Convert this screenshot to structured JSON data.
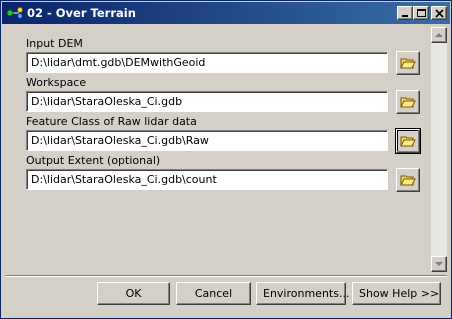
{
  "window": {
    "title": "02 - Over Terrain",
    "icon": "model-tool-icon",
    "controls": [
      "minimize-icon",
      "maximize-icon",
      "close-icon"
    ]
  },
  "parameters": [
    {
      "label": "Input DEM",
      "value": "D:\\lidar\\dmt.gdb\\DEMwithGeoid",
      "browse_icon": "open-folder-icon"
    },
    {
      "label": "Workspace",
      "value": "D:\\lidar\\StaraOleska_Ci.gdb",
      "browse_icon": "open-folder-icon"
    },
    {
      "label": "Feature Class of Raw lidar data",
      "value": "D:\\lidar\\StaraOleska_Ci.gdb\\Raw",
      "browse_icon": "open-folder-icon"
    },
    {
      "label": "Output Extent (optional)",
      "value": "D:\\lidar\\StaraOleska_Ci.gdb\\count",
      "browse_icon": "open-folder-icon"
    }
  ],
  "buttons": {
    "ok": "OK",
    "cancel": "Cancel",
    "environments": "Environments...",
    "show_help": "Show Help >>"
  }
}
